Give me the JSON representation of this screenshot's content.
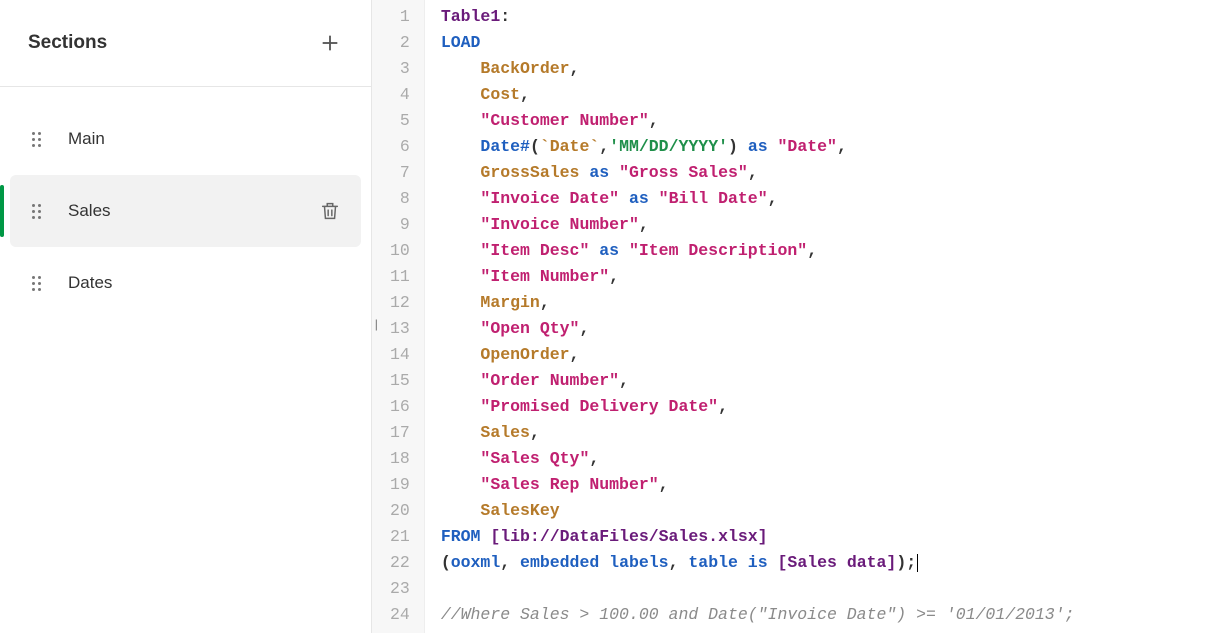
{
  "sidebar": {
    "title": "Sections",
    "items": [
      {
        "label": "Main",
        "active": false,
        "delete": false
      },
      {
        "label": "Sales",
        "active": true,
        "delete": true
      },
      {
        "label": "Dates",
        "active": false,
        "delete": false
      }
    ]
  },
  "editor": {
    "lines": [
      [
        {
          "cls": "t-tbl",
          "t": "Table1"
        },
        {
          "cls": "t-pun",
          "t": ":"
        }
      ],
      [
        {
          "cls": "t-key",
          "t": "LOAD"
        }
      ],
      [
        {
          "cls": "",
          "t": "    "
        },
        {
          "cls": "t-fld",
          "t": "BackOrder"
        },
        {
          "cls": "t-pun",
          "t": ","
        }
      ],
      [
        {
          "cls": "",
          "t": "    "
        },
        {
          "cls": "t-fld",
          "t": "Cost"
        },
        {
          "cls": "t-pun",
          "t": ","
        }
      ],
      [
        {
          "cls": "",
          "t": "    "
        },
        {
          "cls": "t-str",
          "t": "\"Customer Number\""
        },
        {
          "cls": "t-pun",
          "t": ","
        }
      ],
      [
        {
          "cls": "",
          "t": "    "
        },
        {
          "cls": "t-key",
          "t": "Date#"
        },
        {
          "cls": "t-pun",
          "t": "("
        },
        {
          "cls": "t-fld",
          "t": "`Date`"
        },
        {
          "cls": "t-pun",
          "t": ","
        },
        {
          "cls": "t-lit",
          "t": "'MM/DD/YYYY'"
        },
        {
          "cls": "t-pun",
          "t": ")"
        },
        {
          "cls": "",
          "t": " "
        },
        {
          "cls": "t-key",
          "t": "as"
        },
        {
          "cls": "",
          "t": " "
        },
        {
          "cls": "t-str",
          "t": "\"Date\""
        },
        {
          "cls": "t-pun",
          "t": ","
        }
      ],
      [
        {
          "cls": "",
          "t": "    "
        },
        {
          "cls": "t-fld",
          "t": "GrossSales"
        },
        {
          "cls": "",
          "t": " "
        },
        {
          "cls": "t-key",
          "t": "as"
        },
        {
          "cls": "",
          "t": " "
        },
        {
          "cls": "t-str",
          "t": "\"Gross Sales\""
        },
        {
          "cls": "t-pun",
          "t": ","
        }
      ],
      [
        {
          "cls": "",
          "t": "    "
        },
        {
          "cls": "t-str",
          "t": "\"Invoice Date\""
        },
        {
          "cls": "",
          "t": " "
        },
        {
          "cls": "t-key",
          "t": "as"
        },
        {
          "cls": "",
          "t": " "
        },
        {
          "cls": "t-str",
          "t": "\"Bill Date\""
        },
        {
          "cls": "t-pun",
          "t": ","
        }
      ],
      [
        {
          "cls": "",
          "t": "    "
        },
        {
          "cls": "t-str",
          "t": "\"Invoice Number\""
        },
        {
          "cls": "t-pun",
          "t": ","
        }
      ],
      [
        {
          "cls": "",
          "t": "    "
        },
        {
          "cls": "t-str",
          "t": "\"Item Desc\""
        },
        {
          "cls": "",
          "t": " "
        },
        {
          "cls": "t-key",
          "t": "as"
        },
        {
          "cls": "",
          "t": " "
        },
        {
          "cls": "t-str",
          "t": "\"Item Description\""
        },
        {
          "cls": "t-pun",
          "t": ","
        }
      ],
      [
        {
          "cls": "",
          "t": "    "
        },
        {
          "cls": "t-str",
          "t": "\"Item Number\""
        },
        {
          "cls": "t-pun",
          "t": ","
        }
      ],
      [
        {
          "cls": "",
          "t": "    "
        },
        {
          "cls": "t-fld",
          "t": "Margin"
        },
        {
          "cls": "t-pun",
          "t": ","
        }
      ],
      [
        {
          "cls": "",
          "t": "    "
        },
        {
          "cls": "t-str",
          "t": "\"Open Qty\""
        },
        {
          "cls": "t-pun",
          "t": ","
        }
      ],
      [
        {
          "cls": "",
          "t": "    "
        },
        {
          "cls": "t-fld",
          "t": "OpenOrder"
        },
        {
          "cls": "t-pun",
          "t": ","
        }
      ],
      [
        {
          "cls": "",
          "t": "    "
        },
        {
          "cls": "t-str",
          "t": "\"Order Number\""
        },
        {
          "cls": "t-pun",
          "t": ","
        }
      ],
      [
        {
          "cls": "",
          "t": "    "
        },
        {
          "cls": "t-str",
          "t": "\"Promised Delivery Date\""
        },
        {
          "cls": "t-pun",
          "t": ","
        }
      ],
      [
        {
          "cls": "",
          "t": "    "
        },
        {
          "cls": "t-fld",
          "t": "Sales"
        },
        {
          "cls": "t-pun",
          "t": ","
        }
      ],
      [
        {
          "cls": "",
          "t": "    "
        },
        {
          "cls": "t-str",
          "t": "\"Sales Qty\""
        },
        {
          "cls": "t-pun",
          "t": ","
        }
      ],
      [
        {
          "cls": "",
          "t": "    "
        },
        {
          "cls": "t-str",
          "t": "\"Sales Rep Number\""
        },
        {
          "cls": "t-pun",
          "t": ","
        }
      ],
      [
        {
          "cls": "",
          "t": "    "
        },
        {
          "cls": "t-fld",
          "t": "SalesKey"
        }
      ],
      [
        {
          "cls": "t-key",
          "t": "FROM"
        },
        {
          "cls": "",
          "t": " "
        },
        {
          "cls": "t-brk",
          "t": "[lib://DataFiles/Sales.xlsx]"
        }
      ],
      [
        {
          "cls": "t-pun",
          "t": "("
        },
        {
          "cls": "t-key",
          "t": "ooxml"
        },
        {
          "cls": "t-pun",
          "t": ","
        },
        {
          "cls": "",
          "t": " "
        },
        {
          "cls": "t-key",
          "t": "embedded labels"
        },
        {
          "cls": "t-pun",
          "t": ","
        },
        {
          "cls": "",
          "t": " "
        },
        {
          "cls": "t-key",
          "t": "table is"
        },
        {
          "cls": "",
          "t": " "
        },
        {
          "cls": "t-brk",
          "t": "[Sales data]"
        },
        {
          "cls": "t-pun",
          "t": ");"
        },
        {
          "cls": "cursor",
          "t": ""
        }
      ],
      [
        {
          "cls": "",
          "t": ""
        }
      ],
      [
        {
          "cls": "t-cmt",
          "t": "//Where Sales > 100.00 and Date(\"Invoice Date\") >= '01/01/2013';"
        }
      ]
    ]
  }
}
